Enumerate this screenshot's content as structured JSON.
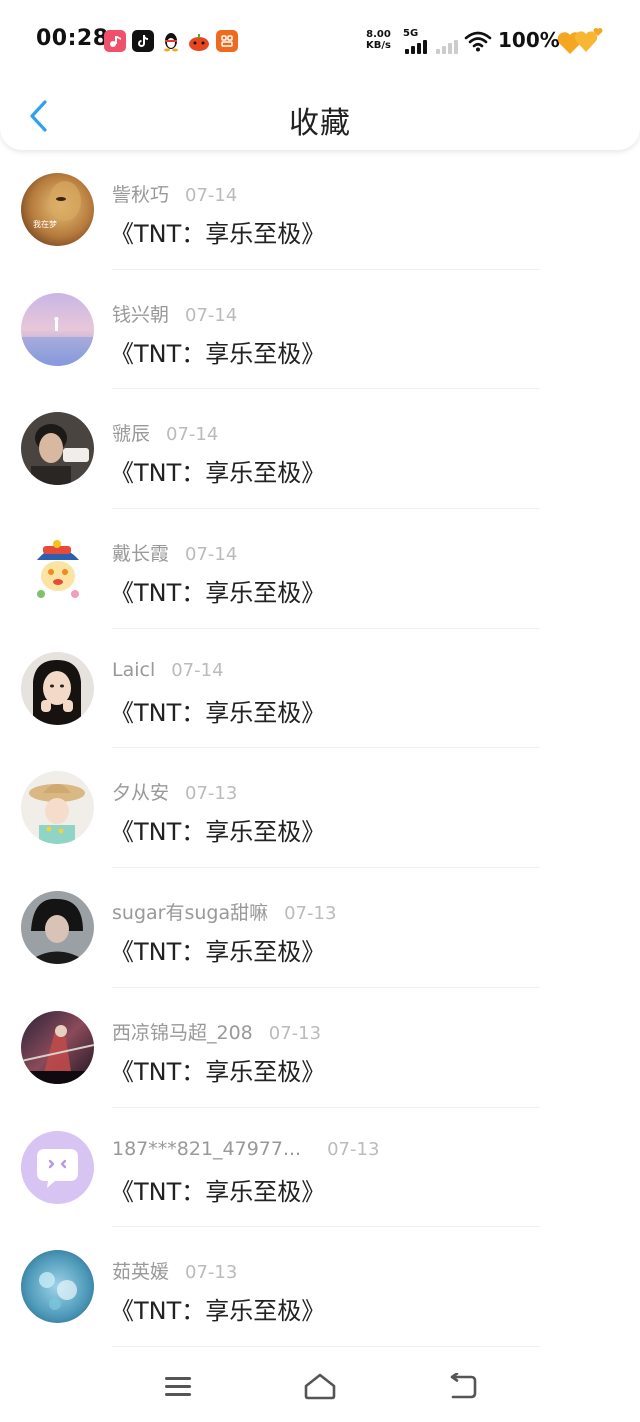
{
  "status_bar": {
    "time": "00:28",
    "net_speed_value": "8.00",
    "net_speed_unit": "KB/s",
    "network_type": "5G",
    "battery": "100%"
  },
  "header": {
    "title": "收藏"
  },
  "items": [
    {
      "name": "訾秋巧",
      "date": "07-14",
      "title": "《TNT：享乐至极》",
      "avatar_caption": "我在梦"
    },
    {
      "name": "钱兴朝",
      "date": "07-14",
      "title": "《TNT：享乐至极》"
    },
    {
      "name": "虢辰",
      "date": "07-14",
      "title": "《TNT：享乐至极》"
    },
    {
      "name": "戴长霞",
      "date": "07-14",
      "title": "《TNT：享乐至极》"
    },
    {
      "name": "Laicl",
      "date": "07-14",
      "title": "《TNT：享乐至极》"
    },
    {
      "name": "夕从安",
      "date": "07-13",
      "title": "《TNT：享乐至极》"
    },
    {
      "name": "sugar有suga甜嘛",
      "date": "07-13",
      "title": "《TNT：享乐至极》"
    },
    {
      "name": "西凉锦马超_208",
      "date": "07-13",
      "title": "《TNT：享乐至极》"
    },
    {
      "name": "187***821_47977...",
      "date": "07-13",
      "title": "《TNT：享乐至极》"
    },
    {
      "name": "茹英媛",
      "date": "07-13",
      "title": "《TNT：享乐至极》"
    }
  ],
  "colors": {
    "accent_blue": "#2ea0f0",
    "name_gray": "#999999",
    "date_gray": "#bbbbbb",
    "title_text": "#222222"
  }
}
